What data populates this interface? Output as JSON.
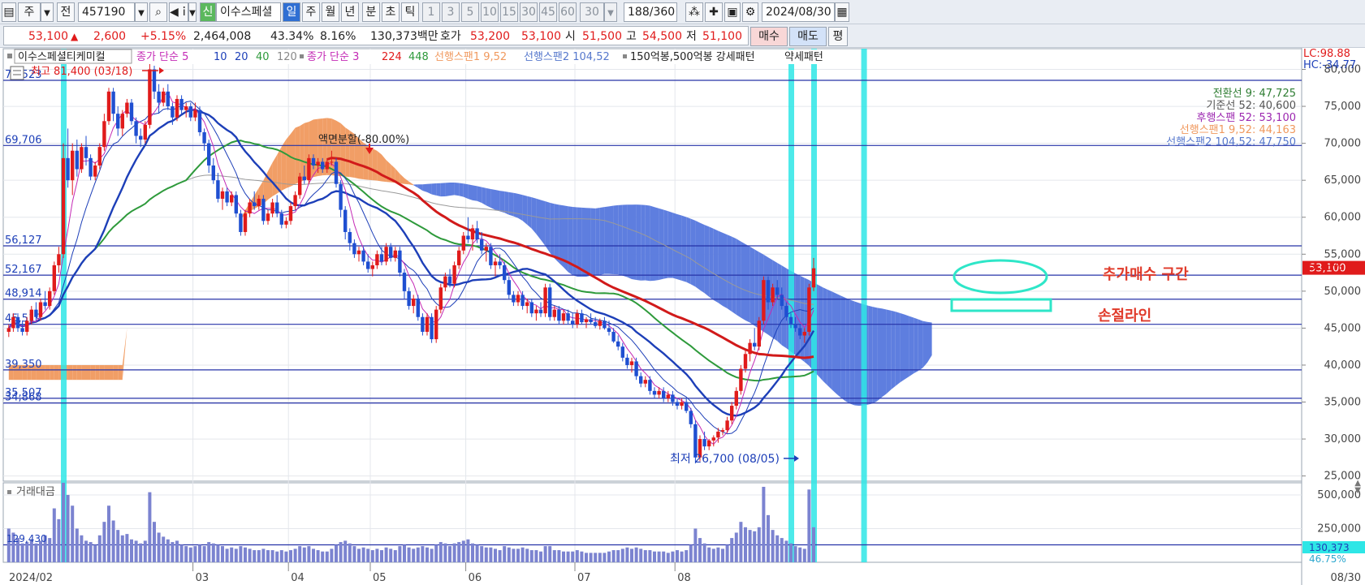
{
  "toolbar": {
    "period_label": "주",
    "prev_label": "전",
    "code": "457190",
    "new_badge": "신",
    "stock_name_short": "이수스페셜",
    "period_day": "일",
    "period_week": "주",
    "period_month": "월",
    "period_year": "년",
    "period_min": "분",
    "period_sec": "초",
    "period_tick": "틱",
    "intervals": [
      "1",
      "3",
      "5",
      "10",
      "15",
      "30",
      "45",
      "60"
    ],
    "interval_select": "30",
    "count": "188",
    "count_total": "/360",
    "date": "2024/08/30"
  },
  "quote": {
    "price": "53,100",
    "change_arrow": "▲",
    "change": "2,600",
    "change_pct": "+5.15%",
    "volume": "2,464,008",
    "vol_ratio": "43.34%",
    "turnover": "8.16%",
    "amount": "130,373백만",
    "ask_label": "호가",
    "ask": "53,200",
    "bid": "53,100",
    "open_label": "시",
    "open": "51,500",
    "high_label": "고",
    "high": "54,500",
    "low_label": "저",
    "low": "51,100",
    "buy_btn": "매수",
    "sell_btn": "매도",
    "eval_btn": "평"
  },
  "legend": {
    "stock_name": "이수스페셜티케미컬",
    "ma_label": "종가 단순 5",
    "ma_10": "10",
    "ma_20": "20",
    "ma_40": "40",
    "ma_120": "120",
    "ma2_label": "종가 단순 3",
    "ma2_224": "224",
    "ma2_448": "448",
    "span1": "선행스팬1 9,52",
    "span2": "선행스팬2 104,52",
    "pattern1": "150억봉,500억봉 강세패턴",
    "pattern2": "약세패턴"
  },
  "ichimoku_legend": [
    {
      "text": "전환선 9: 47,725",
      "color": "#2e7d32"
    },
    {
      "text": "기준선 52: 40,600",
      "color": "#555555"
    },
    {
      "text": "후행스팬 52: 53,100",
      "color": "#9c27b0"
    },
    {
      "text": "선행스팬1 9,52: 44,163",
      "color": "#f0995e"
    },
    {
      "text": "선행스팬2 104,52: 47,750",
      "color": "#5577cc"
    }
  ],
  "right_top": {
    "lc": "LC:98.88",
    "hc": "HC:-34.77"
  },
  "price_tag": {
    "value": "53,100",
    "pct": "5.15%"
  },
  "annotations": {
    "high": "최고 81,400 (03/18)",
    "low": "최저 26,700 (08/05)",
    "split": "액면분할(-80.00%)",
    "add_buy": "추가매수 구간",
    "stop_loss": "손절라인"
  },
  "volume_panel": {
    "title": "거래대금",
    "hline_label": "129,430",
    "last_value": "130,373",
    "last_pct": "46.75%"
  },
  "x_axis": {
    "start": "2024/02",
    "months": [
      "03",
      "04",
      "05",
      "06",
      "07",
      "08"
    ],
    "last_date": "08/30"
  },
  "colors": {
    "up": "#e01b1b",
    "down": "#1f4fd1",
    "cloud_bull": "#f0995e",
    "cloud_bear": "#5577dd",
    "highlight": "#2ee6e6",
    "annotation": "#e03a2a"
  },
  "chart_data": {
    "type": "candlestick",
    "y_axis": {
      "ticks": [
        25000,
        30000,
        35000,
        40000,
        45000,
        50000,
        55000,
        60000,
        65000,
        70000,
        75000,
        80000
      ],
      "ylim": [
        24300,
        82800
      ]
    },
    "horizontal_lines": [
      78523,
      69706,
      56127,
      52167,
      48914,
      45519,
      39350,
      35507,
      34868
    ],
    "horizontal_line_labels": [
      "78,523",
      "69,706",
      "56,127",
      "52,167",
      "48,914",
      "45,519",
      "39,350",
      "35,507",
      "34,868"
    ],
    "volume_axis": {
      "ticks": [
        250000,
        500000
      ],
      "labels": [
        "250,000",
        "500,000"
      ],
      "max": 590000
    },
    "candles": [
      [
        44500,
        45500,
        43800,
        45000,
        250000
      ],
      [
        45000,
        47000,
        44500,
        46500,
        220000
      ],
      [
        46500,
        47000,
        44500,
        45000,
        180000
      ],
      [
        45000,
        46000,
        44000,
        44500,
        140000
      ],
      [
        44500,
        46500,
        44000,
        46000,
        150000
      ],
      [
        46000,
        48000,
        45500,
        47500,
        170000
      ],
      [
        47500,
        48500,
        46000,
        46500,
        140000
      ],
      [
        46500,
        49000,
        46000,
        48500,
        160000
      ],
      [
        48500,
        50000,
        47500,
        48000,
        200000
      ],
      [
        48000,
        50500,
        47500,
        50000,
        180000
      ],
      [
        50000,
        54000,
        49500,
        53500,
        400000
      ],
      [
        53500,
        56000,
        52500,
        55000,
        320000
      ],
      [
        55000,
        70000,
        54500,
        68000,
        590000
      ],
      [
        68000,
        72000,
        64000,
        65000,
        500000
      ],
      [
        65000,
        70000,
        63000,
        69000,
        420000
      ],
      [
        69000,
        70500,
        65500,
        66500,
        250000
      ],
      [
        66500,
        70000,
        66000,
        69500,
        200000
      ],
      [
        69500,
        71000,
        67000,
        68000,
        160000
      ],
      [
        68000,
        68500,
        65000,
        65500,
        150000
      ],
      [
        65500,
        67500,
        65000,
        67000,
        130000
      ],
      [
        67000,
        70000,
        66500,
        69500,
        200000
      ],
      [
        69500,
        74000,
        69000,
        73000,
        300000
      ],
      [
        73000,
        77500,
        72500,
        77000,
        420000
      ],
      [
        77000,
        77500,
        73000,
        74000,
        310000
      ],
      [
        74000,
        75000,
        71000,
        72000,
        240000
      ],
      [
        72000,
        74500,
        71000,
        74000,
        200000
      ],
      [
        74000,
        76000,
        73500,
        75500,
        210000
      ],
      [
        75500,
        76000,
        72500,
        73000,
        170000
      ],
      [
        73000,
        73500,
        70000,
        71000,
        160000
      ],
      [
        71000,
        72000,
        69500,
        70500,
        140000
      ],
      [
        70500,
        73000,
        70000,
        72500,
        160000
      ],
      [
        72500,
        81400,
        72000,
        80000,
        520000
      ],
      [
        80000,
        80500,
        76000,
        77000,
        300000
      ],
      [
        77000,
        78000,
        74000,
        75500,
        220000
      ],
      [
        75500,
        77500,
        75000,
        77000,
        190000
      ],
      [
        77000,
        78000,
        74500,
        75000,
        170000
      ],
      [
        75000,
        75500,
        72500,
        73500,
        150000
      ],
      [
        73500,
        76500,
        73000,
        76000,
        160000
      ],
      [
        76000,
        76500,
        74000,
        74500,
        130000
      ],
      [
        74500,
        75500,
        73500,
        75000,
        120000
      ],
      [
        75000,
        75500,
        73000,
        73500,
        110000
      ],
      [
        73500,
        75500,
        73000,
        74500,
        120000
      ],
      [
        74500,
        75000,
        71000,
        71500,
        130000
      ],
      [
        71500,
        72000,
        69000,
        70000,
        120000
      ],
      [
        70000,
        70500,
        66000,
        67000,
        150000
      ],
      [
        67000,
        68000,
        64500,
        65000,
        140000
      ],
      [
        65000,
        66000,
        62000,
        62500,
        130000
      ],
      [
        62500,
        64000,
        61000,
        63500,
        120000
      ],
      [
        63500,
        64000,
        61500,
        62000,
        100000
      ],
      [
        62000,
        63500,
        61500,
        63000,
        110000
      ],
      [
        63000,
        63500,
        60000,
        60500,
        100000
      ],
      [
        60500,
        61000,
        57500,
        58000,
        120000
      ],
      [
        58000,
        61000,
        57500,
        60500,
        110000
      ],
      [
        60500,
        62500,
        60000,
        62000,
        100000
      ],
      [
        62000,
        63500,
        61000,
        61500,
        90000
      ],
      [
        61500,
        63000,
        61000,
        62500,
        90000
      ],
      [
        62500,
        63000,
        59000,
        59500,
        100000
      ],
      [
        59500,
        61000,
        59000,
        60500,
        90000
      ],
      [
        60500,
        62500,
        60000,
        62000,
        90000
      ],
      [
        62000,
        63000,
        60000,
        60500,
        80000
      ],
      [
        60500,
        61000,
        58500,
        59000,
        90000
      ],
      [
        59000,
        60000,
        58500,
        59500,
        80000
      ],
      [
        59500,
        62000,
        59000,
        61500,
        90000
      ],
      [
        61500,
        63500,
        61000,
        63000,
        100000
      ],
      [
        63000,
        66000,
        62500,
        65500,
        120000
      ],
      [
        65500,
        67000,
        64500,
        65000,
        110000
      ],
      [
        65000,
        68500,
        64500,
        68000,
        120000
      ],
      [
        68000,
        68500,
        66500,
        67000,
        100000
      ],
      [
        67000,
        68000,
        66000,
        67500,
        90000
      ],
      [
        67500,
        68000,
        66000,
        66500,
        80000
      ],
      [
        66500,
        68000,
        66000,
        67500,
        80000
      ],
      [
        67500,
        69000,
        67000,
        67500,
        100000
      ],
      [
        67500,
        68000,
        64000,
        64500,
        130000
      ],
      [
        64500,
        65000,
        60000,
        61000,
        150000
      ],
      [
        61000,
        61500,
        57000,
        58000,
        160000
      ],
      [
        58000,
        58500,
        55500,
        56500,
        140000
      ],
      [
        56500,
        57000,
        54500,
        55000,
        120000
      ],
      [
        55000,
        56000,
        54000,
        55500,
        100000
      ],
      [
        55500,
        56000,
        53500,
        54000,
        110000
      ],
      [
        54000,
        55000,
        52500,
        53000,
        100000
      ],
      [
        53000,
        54000,
        52000,
        53500,
        90000
      ],
      [
        53500,
        55500,
        53000,
        55000,
        100000
      ],
      [
        55000,
        56000,
        53500,
        54000,
        90000
      ],
      [
        54000,
        56500,
        53500,
        56000,
        110000
      ],
      [
        56000,
        56500,
        54000,
        54500,
        100000
      ],
      [
        54500,
        56000,
        54000,
        55500,
        90000
      ],
      [
        55500,
        56000,
        52000,
        52500,
        120000
      ],
      [
        52500,
        53000,
        49000,
        50000,
        130000
      ],
      [
        50000,
        50500,
        47500,
        48000,
        110000
      ],
      [
        48000,
        49500,
        47000,
        49000,
        100000
      ],
      [
        49000,
        49500,
        46000,
        46500,
        110000
      ],
      [
        46500,
        47000,
        44000,
        44500,
        120000
      ],
      [
        44500,
        47000,
        44000,
        46500,
        110000
      ],
      [
        46500,
        47000,
        43000,
        43500,
        100000
      ],
      [
        43500,
        48000,
        43000,
        47500,
        130000
      ],
      [
        47500,
        51000,
        47000,
        50500,
        150000
      ],
      [
        50500,
        52500,
        50000,
        52000,
        140000
      ],
      [
        52000,
        53000,
        50500,
        51000,
        120000
      ],
      [
        51000,
        54000,
        50500,
        53500,
        140000
      ],
      [
        53500,
        56000,
        53000,
        55500,
        150000
      ],
      [
        55500,
        58000,
        55000,
        57500,
        160000
      ],
      [
        57500,
        60000,
        56500,
        57000,
        170000
      ],
      [
        57000,
        59000,
        55500,
        58500,
        140000
      ],
      [
        58500,
        59500,
        56500,
        57000,
        130000
      ],
      [
        57000,
        58000,
        55000,
        55500,
        120000
      ],
      [
        55500,
        56500,
        54000,
        56000,
        110000
      ],
      [
        56000,
        56500,
        53000,
        53500,
        110000
      ],
      [
        53500,
        54500,
        52000,
        54000,
        100000
      ],
      [
        54000,
        55000,
        53000,
        53500,
        90000
      ],
      [
        53500,
        54000,
        51000,
        51500,
        120000
      ],
      [
        51500,
        52000,
        49000,
        49500,
        110000
      ],
      [
        49500,
        50000,
        48000,
        48500,
        100000
      ],
      [
        48500,
        50000,
        48000,
        49500,
        100000
      ],
      [
        49500,
        50000,
        47500,
        48000,
        110000
      ],
      [
        48000,
        49000,
        47000,
        48500,
        100000
      ],
      [
        48500,
        49000,
        46500,
        47000,
        90000
      ],
      [
        47000,
        48000,
        46000,
        47500,
        90000
      ],
      [
        47500,
        48500,
        46500,
        47000,
        80000
      ],
      [
        47000,
        51000,
        46500,
        50500,
        120000
      ],
      [
        50500,
        51000,
        46000,
        46500,
        120000
      ],
      [
        46500,
        48000,
        46000,
        47500,
        90000
      ],
      [
        47500,
        48000,
        45500,
        46000,
        90000
      ],
      [
        46000,
        47500,
        45500,
        47000,
        80000
      ],
      [
        47000,
        47500,
        45500,
        46000,
        80000
      ],
      [
        46000,
        47000,
        45000,
        45500,
        80000
      ],
      [
        45500,
        47500,
        45000,
        47000,
        90000
      ],
      [
        47000,
        47500,
        45500,
        45800,
        80000
      ],
      [
        45800,
        46500,
        45000,
        46200,
        70000
      ],
      [
        46200,
        47000,
        45500,
        45800,
        70000
      ],
      [
        45800,
        46500,
        45000,
        45300,
        70000
      ],
      [
        45300,
        46300,
        44800,
        46000,
        70000
      ],
      [
        46000,
        46500,
        44800,
        45000,
        70000
      ],
      [
        45000,
        46000,
        44000,
        44500,
        80000
      ],
      [
        44500,
        45000,
        43000,
        43200,
        90000
      ],
      [
        43200,
        44000,
        42000,
        42500,
        90000
      ],
      [
        42500,
        43000,
        40500,
        41000,
        100000
      ],
      [
        41000,
        41500,
        39500,
        40000,
        110000
      ],
      [
        40000,
        41000,
        39000,
        40500,
        100000
      ],
      [
        40500,
        41000,
        38000,
        38500,
        110000
      ],
      [
        38500,
        39000,
        37000,
        37500,
        100000
      ],
      [
        37500,
        38500,
        37000,
        38000,
        90000
      ],
      [
        38000,
        38500,
        36000,
        36500,
        90000
      ],
      [
        36500,
        37000,
        35500,
        36000,
        80000
      ],
      [
        36000,
        37000,
        35500,
        36500,
        80000
      ],
      [
        36500,
        37000,
        35000,
        35500,
        80000
      ],
      [
        35500,
        36500,
        35000,
        36000,
        70000
      ],
      [
        36000,
        36500,
        34500,
        35000,
        80000
      ],
      [
        35000,
        35500,
        34000,
        34500,
        90000
      ],
      [
        34500,
        35500,
        34000,
        35000,
        80000
      ],
      [
        35000,
        35500,
        33500,
        33800,
        90000
      ],
      [
        33800,
        34200,
        31500,
        32000,
        130000
      ],
      [
        32000,
        32500,
        26700,
        27500,
        250000
      ],
      [
        27500,
        30500,
        27000,
        30000,
        180000
      ],
      [
        30000,
        31000,
        28500,
        29000,
        140000
      ],
      [
        29000,
        30000,
        28500,
        29800,
        110000
      ],
      [
        29800,
        30500,
        29000,
        30200,
        100000
      ],
      [
        30200,
        31500,
        29500,
        31000,
        110000
      ],
      [
        31000,
        31500,
        30500,
        31200,
        100000
      ],
      [
        31200,
        33000,
        30800,
        32500,
        130000
      ],
      [
        32500,
        35000,
        32000,
        34500,
        180000
      ],
      [
        34500,
        37000,
        34000,
        36500,
        220000
      ],
      [
        36500,
        40000,
        36000,
        39500,
        300000
      ],
      [
        39500,
        42000,
        39000,
        41500,
        260000
      ],
      [
        41500,
        43500,
        40500,
        43000,
        240000
      ],
      [
        43000,
        45000,
        42000,
        42500,
        230000
      ],
      [
        42500,
        46500,
        42000,
        46000,
        260000
      ],
      [
        46000,
        52000,
        45500,
        51500,
        560000
      ],
      [
        51500,
        52000,
        47500,
        48500,
        350000
      ],
      [
        48500,
        51000,
        48000,
        50500,
        240000
      ],
      [
        50500,
        51500,
        49000,
        49500,
        200000
      ],
      [
        49500,
        50500,
        47500,
        48000,
        180000
      ],
      [
        48000,
        48500,
        46000,
        46500,
        160000
      ],
      [
        46500,
        47000,
        45000,
        45500,
        140000
      ],
      [
        45500,
        46500,
        44500,
        45000,
        120000
      ],
      [
        45000,
        45500,
        43500,
        44000,
        110000
      ],
      [
        44000,
        45000,
        43000,
        44500,
        100000
      ],
      [
        44500,
        51000,
        44000,
        50500,
        540000
      ],
      [
        50500,
        54500,
        50000,
        53100,
        260000
      ]
    ]
  }
}
